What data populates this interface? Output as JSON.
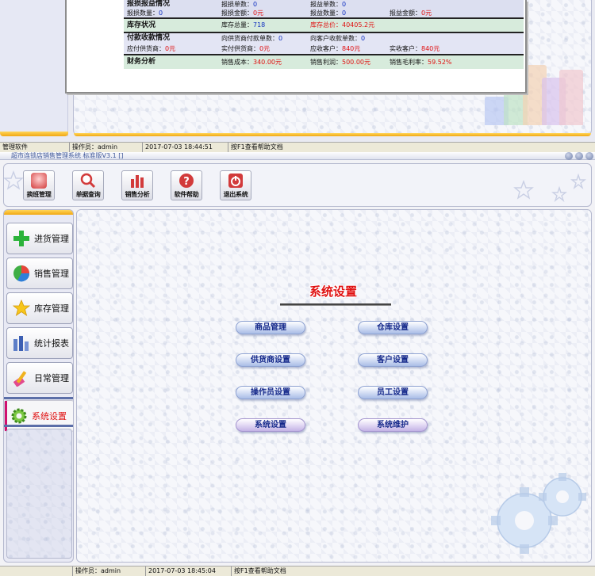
{
  "old_window": {
    "stats": {
      "rows": [
        {
          "cells": [
            "报损报益情况",
            "报损单数：0",
            "报益单数：0",
            ""
          ]
        },
        {
          "cells": [
            "报损数量：0",
            "报损金额：0元",
            "报益数量：0",
            "报益金额：0元"
          ]
        },
        {
          "cells": [
            "库存状况",
            "库存总量：718",
            "库存总价：40405.2元",
            ""
          ]
        },
        {
          "cells": [
            "付款收款情况",
            "向供货商付款单数：0",
            "向客户收款单数：0",
            ""
          ]
        },
        {
          "cells": [
            "应付供货商：0元",
            "实付供货商：0元",
            "应收客户：840元",
            "实收客户：840元"
          ]
        },
        {
          "cells": [
            "财务分析",
            "销售成本：340.00元",
            "销售利润：500.00元",
            "销售毛利率：59.52%"
          ]
        }
      ]
    },
    "status": {
      "software": "管理软件",
      "operator": "操作员：admin",
      "datetime": "2017-07-03 18:44:51",
      "help": "按F1查看帮助文档"
    }
  },
  "titlebar": {
    "title": "超市连锁店销售管理系统 标准版V3.1 []"
  },
  "toolbar": {
    "buttons": [
      {
        "label": "换班管理"
      },
      {
        "label": "单据查询"
      },
      {
        "label": "销售分析"
      },
      {
        "label": "软件帮助"
      },
      {
        "label": "退出系统"
      }
    ]
  },
  "leftnav": {
    "items": [
      {
        "label": "进货管理"
      },
      {
        "label": "销售管理"
      },
      {
        "label": "库存管理"
      },
      {
        "label": "统计报表"
      },
      {
        "label": "日常管理"
      },
      {
        "label": "系统设置"
      }
    ]
  },
  "main": {
    "title": "系统设置",
    "buttons": [
      {
        "label": "商品管理"
      },
      {
        "label": "仓库设置"
      },
      {
        "label": "供货商设置"
      },
      {
        "label": "客户设置"
      },
      {
        "label": "操作员设置"
      },
      {
        "label": "员工设置"
      },
      {
        "label": "系统设置"
      },
      {
        "label": "系统维护"
      }
    ]
  },
  "status": {
    "operator": "操作员：admin",
    "datetime": "2017-07-03 18:45:04",
    "help": "按F1查看帮助文档"
  },
  "colors": {
    "accent_gold": "#f1a712",
    "title_red": "#e01010",
    "button_blue": "#14288a"
  }
}
